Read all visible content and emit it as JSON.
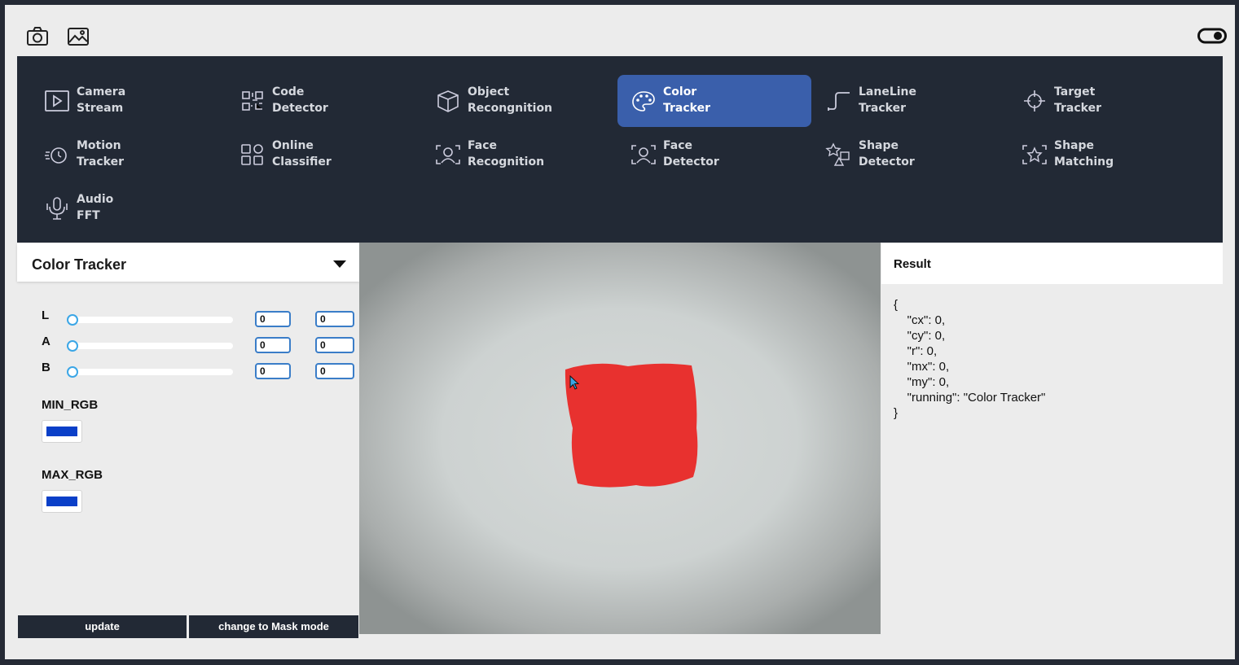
{
  "toolbar": {
    "camera_icon": "camera-icon",
    "image_icon": "image-icon",
    "toggle_icon": "toggle-icon"
  },
  "nav": {
    "active_color": "#3a5fab",
    "items": [
      {
        "l1": "Camera",
        "l2": "Stream",
        "icon": "play-icon"
      },
      {
        "l1": "Code",
        "l2": "Detector",
        "icon": "qr-code-icon"
      },
      {
        "l1": "Object",
        "l2": "Recongnition",
        "icon": "cube-icon"
      },
      {
        "l1": "Color",
        "l2": "Tracker",
        "icon": "palette-icon",
        "active": true
      },
      {
        "l1": "LaneLine",
        "l2": "Tracker",
        "icon": "lane-icon"
      },
      {
        "l1": "Target",
        "l2": "Tracker",
        "icon": "crosshair-icon"
      },
      {
        "l1": "Motion",
        "l2": "Tracker",
        "icon": "motion-icon"
      },
      {
        "l1": "Online",
        "l2": "Classifier",
        "icon": "grid-icon"
      },
      {
        "l1": "Face",
        "l2": "Recognition",
        "icon": "face-scan-icon"
      },
      {
        "l1": "Face",
        "l2": "Detector",
        "icon": "face-scan-icon"
      },
      {
        "l1": "Shape",
        "l2": "Detector",
        "icon": "shapes-icon"
      },
      {
        "l1": "Shape",
        "l2": "Matching",
        "icon": "star-scan-icon"
      },
      {
        "l1": "Audio",
        "l2": "FFT",
        "icon": "microphone-icon"
      }
    ]
  },
  "panel": {
    "title": "Color Tracker",
    "sliders": [
      {
        "label": "L",
        "value": 0,
        "min": "0",
        "max": "0"
      },
      {
        "label": "A",
        "value": 0,
        "min": "0",
        "max": "0"
      },
      {
        "label": "B",
        "value": 0,
        "min": "0",
        "max": "0"
      }
    ],
    "min_rgb_label": "MIN_RGB",
    "min_rgb_color": "#0a3fc8",
    "max_rgb_label": "MAX_RGB",
    "max_rgb_color": "#0a3fc8",
    "update_label": "update",
    "mode_label": "change to Mask mode"
  },
  "camera": {
    "blob_color": "#e8312f"
  },
  "result": {
    "title": "Result",
    "lines": [
      "{",
      "    \"cx\": 0,",
      "    \"cy\": 0,",
      "    \"r\": 0,",
      "    \"mx\": 0,",
      "    \"my\": 0,",
      "    \"running\": \"Color Tracker\"",
      "}"
    ]
  }
}
